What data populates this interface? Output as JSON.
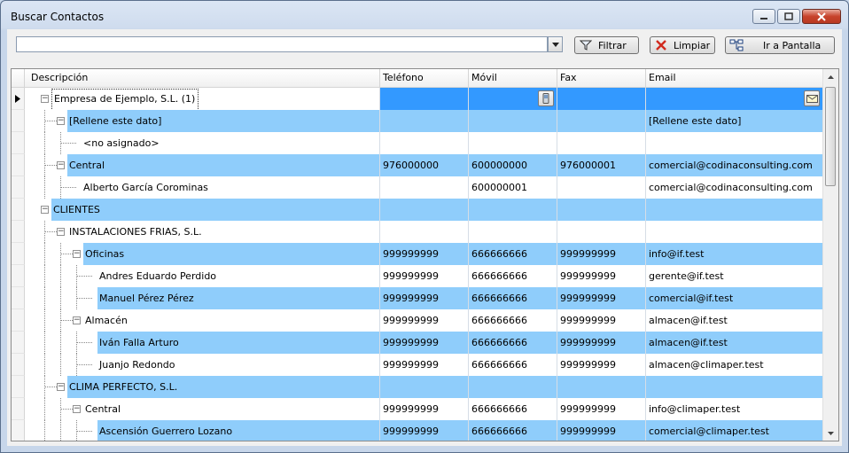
{
  "window": {
    "title": "Buscar Contactos"
  },
  "toolbar": {
    "search_value": "",
    "filter_label": "Filtrar",
    "clear_label": "Limpiar",
    "goto_label": "Ir a Pantalla"
  },
  "grid": {
    "columns": [
      "Descripción",
      "Teléfono",
      "Móvil",
      "Fax",
      "Email"
    ],
    "rows": [
      {
        "desc": "Empresa de Ejemplo, S.L. (1)",
        "tel": "",
        "movil": "",
        "fax": "",
        "email": ""
      },
      {
        "desc": "[Rellene este dato]",
        "tel": "",
        "movil": "",
        "fax": "",
        "email": "[Rellene este dato]"
      },
      {
        "desc": "<no asignado>",
        "tel": "",
        "movil": "",
        "fax": "",
        "email": ""
      },
      {
        "desc": "Central",
        "tel": "976000000",
        "movil": "600000000",
        "fax": "976000001",
        "email": "comercial@codinaconsulting.com"
      },
      {
        "desc": "Alberto García Corominas",
        "tel": "",
        "movil": "600000001",
        "fax": "",
        "email": "comercial@codinaconsulting.com"
      },
      {
        "desc": "CLIENTES",
        "tel": "",
        "movil": "",
        "fax": "",
        "email": ""
      },
      {
        "desc": "INSTALACIONES FRIAS, S.L.",
        "tel": "",
        "movil": "",
        "fax": "",
        "email": ""
      },
      {
        "desc": "Oficinas",
        "tel": "999999999",
        "movil": "666666666",
        "fax": "999999999",
        "email": "info@if.test"
      },
      {
        "desc": "Andres Eduardo Perdido",
        "tel": "999999999",
        "movil": "666666666",
        "fax": "999999999",
        "email": "gerente@if.test"
      },
      {
        "desc": "Manuel Pérez Pérez",
        "tel": "999999999",
        "movil": "666666666",
        "fax": "999999999",
        "email": "comercial@if.test"
      },
      {
        "desc": "Almacén",
        "tel": "999999999",
        "movil": "666666666",
        "fax": "999999999",
        "email": "almacen@if.test"
      },
      {
        "desc": "Iván Falla Arturo",
        "tel": "999999999",
        "movil": "666666666",
        "fax": "999999999",
        "email": "almacen@if.test"
      },
      {
        "desc": "Juanjo Redondo",
        "tel": "999999999",
        "movil": "666666666",
        "fax": "999999999",
        "email": "almacen@climaper.test"
      },
      {
        "desc": "CLIMA PERFECTO, S.L.",
        "tel": "",
        "movil": "",
        "fax": "",
        "email": ""
      },
      {
        "desc": "Central",
        "tel": "999999999",
        "movil": "666666666",
        "fax": "999999999",
        "email": "info@climaper.test"
      },
      {
        "desc": "Ascensión Guerrero Lozano",
        "tel": "999999999",
        "movil": "666666666",
        "fax": "999999999",
        "email": "comercial@climaper.test"
      }
    ]
  },
  "icons": {
    "filter": "filter-funnel-icon",
    "clear": "red-x-icon",
    "goto": "screen-tree-icon",
    "mobile": "mobile-phone-icon",
    "email": "envelope-icon"
  },
  "colors": {
    "highlight_row": "#8fcdfb",
    "selected_cell": "#3399ff"
  }
}
